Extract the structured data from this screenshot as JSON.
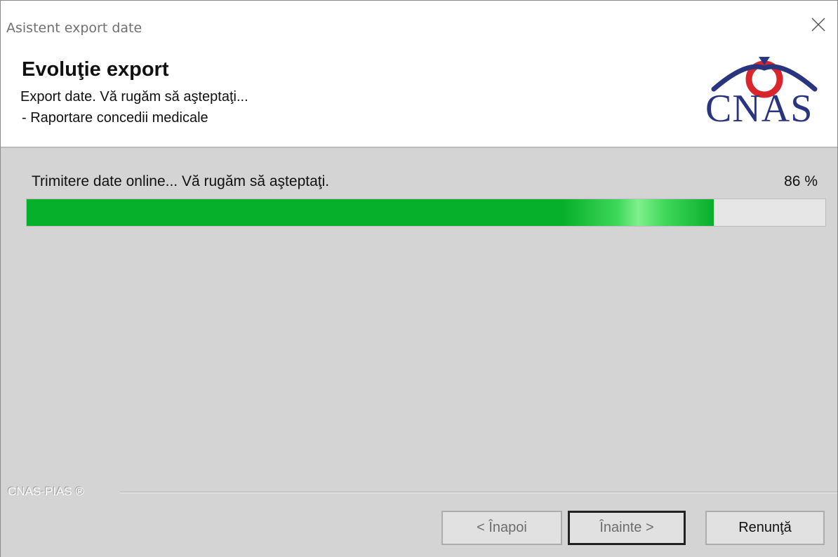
{
  "window": {
    "title": "Asistent export date",
    "close_icon": "close-icon"
  },
  "header": {
    "title": "Evoluţie export",
    "subtitle": "Export date. Vă rugăm să aşteptaţi...",
    "detail": " - Raportare concedii medicale",
    "logo_text": "CNAS",
    "logo_colors": {
      "arc": "#2a3580",
      "circle": "#d8262c",
      "text": "#2a3580"
    }
  },
  "progress": {
    "status": "Trimitere date online... Vă rugăm să aşteptaţi.",
    "percent_label": "86 %",
    "value": 0.86,
    "fill_color": "#06b02a"
  },
  "footer": {
    "brand": "CNAS-PIAS ®",
    "buttons": {
      "back": "< Înapoi",
      "next": "Înainte >",
      "cancel": "Renunţă"
    }
  }
}
